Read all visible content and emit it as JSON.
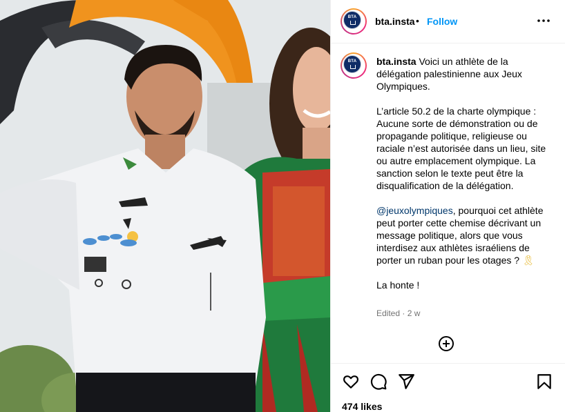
{
  "post": {
    "author": {
      "handle": "bta.insta",
      "avatar_text": "BTA"
    },
    "follow_label": "Follow",
    "separator": "•",
    "caption": {
      "handle": "bta.insta",
      "intro": "Voici un athlète de la délégation palestinienne aux Jeux Olympiques.",
      "paragraph2": "L’article 50.2 de la charte olympique : Aucune sorte de démonstration ou de propagande politique, religieuse ou raciale n’est autorisée dans un lieu, site ou autre emplacement olympique. La sanction selon le texte peut être la disqualification de la délégation.",
      "mention": "@jeuxolympiques",
      "paragraph3_rest": ", pourquoi cet athlète peut porter cette chemise décrivant un message politique, alors que vous interdisez aux athlètes israéliens de porter un ruban pour les otages ? ",
      "ribbon_emoji": "🎗",
      "paragraph4": "La honte !"
    },
    "edited_label": "Edited · 2 w",
    "likes": "474 likes",
    "icons": {
      "more": "more-options-icon",
      "add_comment": "add-comment-icon",
      "like": "heart-icon",
      "comment": "comment-icon",
      "share": "share-icon",
      "save": "bookmark-icon"
    },
    "colors": {
      "follow": "#0095f6",
      "mention": "#00376b",
      "muted": "#737373"
    }
  }
}
